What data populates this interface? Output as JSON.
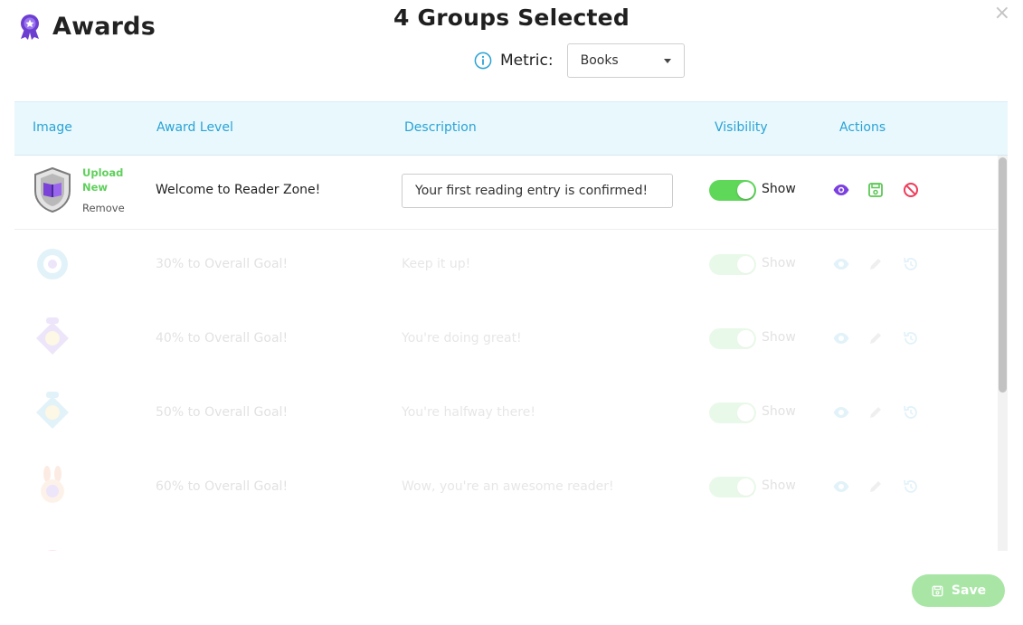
{
  "header": {
    "title": "Awards",
    "icon": "award-ribbon-icon",
    "group_title": "4 Groups Selected",
    "close_label": "×"
  },
  "metric": {
    "label": "Metric:",
    "selected": "Books",
    "info_icon": "info-icon"
  },
  "table": {
    "columns": [
      "Image",
      "Award Level",
      "Description",
      "Visibility",
      "Actions"
    ],
    "upload_label": "Upload New",
    "remove_label": "Remove",
    "rows": [
      {
        "level": "Welcome to Reader Zone!",
        "description": "Your first reading entry is confirmed!",
        "visibility": "Show",
        "visible": true,
        "editing": true,
        "badge": "shield-book-badge-icon"
      },
      {
        "level": "30% to Overall Goal!",
        "description": "Keep it up!",
        "visibility": "Show",
        "visible": true,
        "editing": false,
        "badge": "ring-badge-icon"
      },
      {
        "level": "40% to Overall Goal!",
        "description": "You're doing great!",
        "visibility": "Show",
        "visible": true,
        "editing": false,
        "badge": "diamond-badge-icon"
      },
      {
        "level": "50% to Overall Goal!",
        "description": "You're halfway there!",
        "visibility": "Show",
        "visible": true,
        "editing": false,
        "badge": "diamond-badge-icon"
      },
      {
        "level": "60% to Overall Goal!",
        "description": "Wow, you're an awesome reader!",
        "visibility": "Show",
        "visible": true,
        "editing": false,
        "badge": "bunny-badge-icon"
      }
    ]
  },
  "footer": {
    "save_label": "Save"
  },
  "colors": {
    "accent_blue": "#2aa3d5",
    "brand_purple": "#6c3fd1",
    "toggle_green": "#5fd85a",
    "upload_green": "#5fd05b",
    "delete_red": "#ef3b5a",
    "header_bg": "#e9f8fd",
    "save_bg": "#a9e6a6"
  }
}
